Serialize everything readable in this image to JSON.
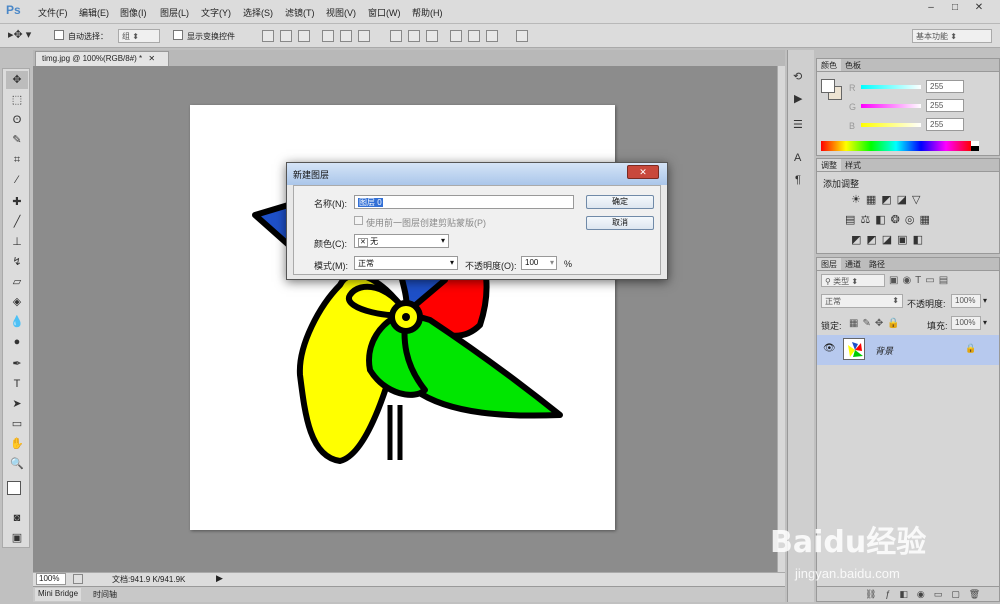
{
  "app": {
    "logo": "Ps",
    "menus": [
      "文件(F)",
      "编辑(E)",
      "图像(I)",
      "图层(L)",
      "文字(Y)",
      "选择(S)",
      "滤镜(T)",
      "视图(V)",
      "窗口(W)",
      "帮助(H)"
    ],
    "window_controls": [
      "–",
      "□",
      "✕"
    ]
  },
  "options": {
    "auto_select_label": "自动选择：",
    "auto_select_value": "组",
    "show_transform_label": "显示变换控件",
    "workspace": "基本功能"
  },
  "document": {
    "tab_title": "timg.jpg @ 100%(RGB/8#) *"
  },
  "dialog": {
    "title": "新建图层",
    "name_label": "名称(N):",
    "name_value": "图层 0",
    "clip_label": "使用前一图层创建剪贴蒙版(P)",
    "color_label": "颜色(C):",
    "color_value": "无",
    "mode_label": "模式(M):",
    "mode_value": "正常",
    "opacity_label": "不透明度(O):",
    "opacity_value": "100",
    "opacity_unit": "%",
    "ok_label": "确定",
    "cancel_label": "取消"
  },
  "status": {
    "zoom": "100%",
    "doc_info": "文档:941.9 K/941.9K"
  },
  "bottom_tabs": [
    "Mini Bridge",
    "时间轴"
  ],
  "panels": {
    "color": {
      "tabs": [
        "颜色",
        "色板"
      ],
      "r_label": "R",
      "r_value": "255",
      "g_label": "G",
      "g_value": "255",
      "b_label": "B",
      "b_value": "255"
    },
    "adjust": {
      "tabs": [
        "调整",
        "样式"
      ],
      "add_label": "添加调整"
    },
    "layers": {
      "tabs": [
        "图层",
        "通道",
        "路径"
      ],
      "kind": "类型",
      "blend": "正常",
      "opacity_label": "不透明度:",
      "opacity": "100%",
      "lock_label": "锁定:",
      "fill_label": "填充:",
      "fill": "100%",
      "layer_name": "背景"
    }
  },
  "watermark": {
    "line1": "Baidu经验",
    "line2": "jingyan.baidu.com"
  }
}
